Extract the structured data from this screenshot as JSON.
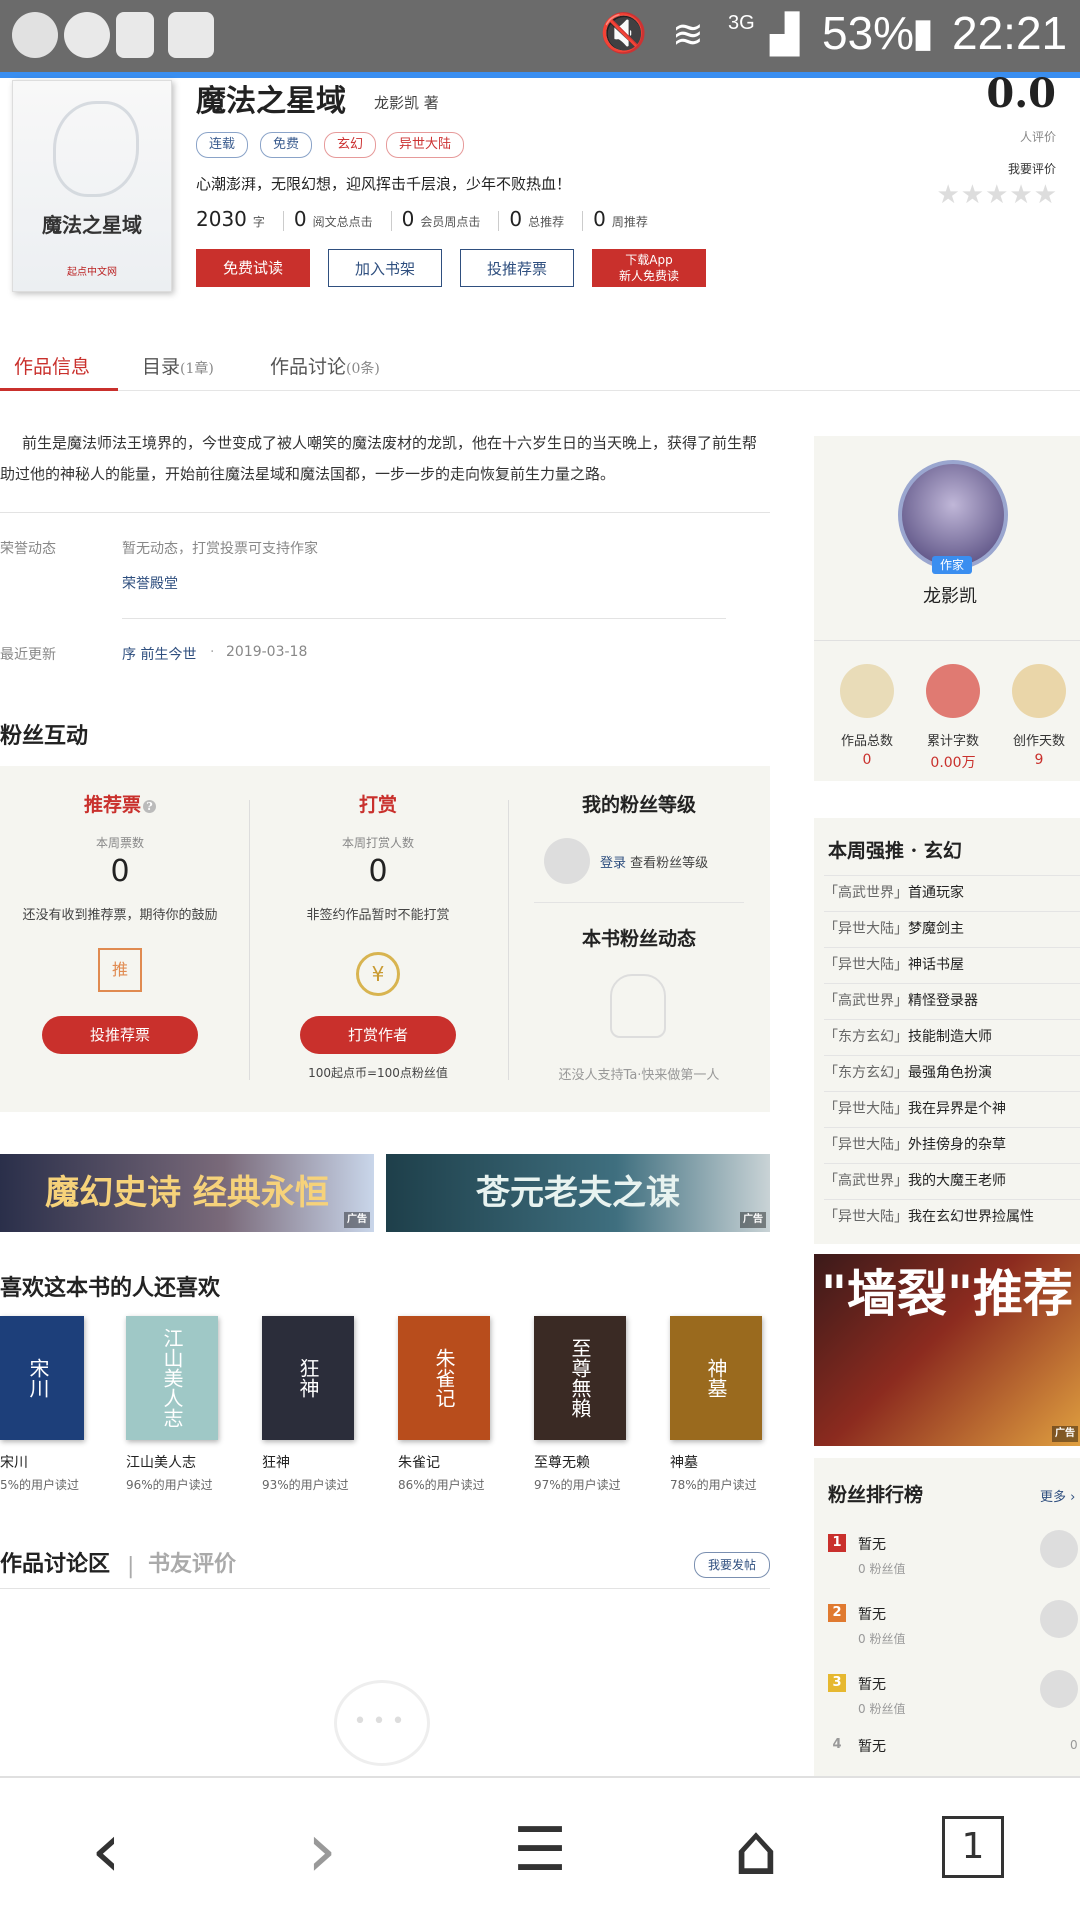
{
  "status_bar": {
    "battery": "53%",
    "time": "22:21",
    "network": "3G"
  },
  "book": {
    "title": "魔法之星域",
    "author": "龙影凯 著",
    "cover_title": "魔法之星域",
    "cover_brand": "起点中文网",
    "tags": [
      {
        "label": "连载",
        "tone": "blue"
      },
      {
        "label": "免费",
        "tone": "blue"
      },
      {
        "label": "玄幻",
        "tone": "red"
      },
      {
        "label": "异世大陆",
        "tone": "red"
      }
    ],
    "intro": "心潮澎湃，无限幻想，迎风挥击千层浪，少年不败热血！",
    "stats": [
      {
        "value": "2030",
        "unit": "字"
      },
      {
        "value": "0",
        "unit": "阅文总点击"
      },
      {
        "value": "0",
        "unit": "会员周点击"
      },
      {
        "value": "0",
        "unit": "总推荐"
      },
      {
        "value": "0",
        "unit": "周推荐"
      }
    ],
    "buttons": {
      "read": "免费试读",
      "shelf": "加入书架",
      "vote": "投推荐票",
      "app_line1": "下载App",
      "app_line2": "新人免费读"
    },
    "rating": {
      "score": "0.0",
      "count_label": "人评价",
      "rate_label": "我要评价",
      "stars": "★★★★★"
    }
  },
  "tabs": [
    {
      "label": "作品信息",
      "sub": ""
    },
    {
      "label": "目录",
      "sub": "(1章)"
    },
    {
      "label": "作品讨论",
      "sub": "(0条)"
    }
  ],
  "description": "前生是魔法师法王境界的，今世变成了被人嘲笑的魔法废材的龙凯，他在十六岁生日的当天晚上，获得了前生帮助过他的神秘人的能量，开始前往魔法星域和魔法国都，一步一步的走向恢复前生力量之路。",
  "honor": {
    "label": "荣誉动态",
    "text": "暂无动态，打赏投票可支持作家",
    "link": "荣誉殿堂"
  },
  "update": {
    "label": "最近更新",
    "chapter": "序 前生今世",
    "dot": "·",
    "date": "2019-03-18"
  },
  "fans": {
    "title": "粉丝互动",
    "vote": {
      "title": "推荐票",
      "help": "?",
      "sub": "本周票数",
      "count": "0",
      "note": "还没有收到推荐票，期待你的鼓励",
      "icon_text": "推",
      "button": "投推荐票"
    },
    "tip": {
      "title": "打赏",
      "sub": "本周打赏人数",
      "count": "0",
      "note": "非签约作品暂时不能打赏",
      "icon_text": "¥",
      "button": "打赏作者",
      "footer": "100起点币=100点粉丝值"
    },
    "level": {
      "title": "我的粉丝等级",
      "login": "登录",
      "login_note": "查看粉丝等级",
      "dynamic_title": "本书粉丝动态",
      "empty": "还没人支持Ta·快来做第一人"
    }
  },
  "banners": [
    {
      "text": "魔幻史诗 经典永恒",
      "ad": "广告"
    },
    {
      "text": "苍元老夫之谋",
      "ad": "广告"
    }
  ],
  "also_like": {
    "title": "喜欢这本书的人还喜欢",
    "books": [
      {
        "cover": "宋川",
        "name": "宋川",
        "pct": "5%的用户读过",
        "color": "#1d3f7a"
      },
      {
        "cover": "江山美人志",
        "name": "江山美人志",
        "pct": "96%的用户读过",
        "color": "#9fc8c6"
      },
      {
        "cover": "狂神",
        "name": "狂神",
        "pct": "93%的用户读过",
        "color": "#2b2d3a"
      },
      {
        "cover": "朱雀记",
        "name": "朱雀记",
        "pct": "86%的用户读过",
        "color": "#b84d1c"
      },
      {
        "cover": "至尊無賴",
        "name": "至尊无赖",
        "pct": "97%的用户读过",
        "color": "#3a2a24"
      },
      {
        "cover": "神墓",
        "name": "神墓",
        "pct": "78%的用户读过",
        "color": "#9a6a1e"
      }
    ]
  },
  "discussion": {
    "title": "作品讨论区",
    "sep": "|",
    "review": "书友评价",
    "post": "我要发帖",
    "dots": "•••"
  },
  "author": {
    "badge": "作家",
    "name": "龙影凯",
    "stats": [
      {
        "label": "作品总数",
        "value": "0",
        "color": "#e9dcb8"
      },
      {
        "label": "累计字数",
        "value": "0.00万",
        "color": "#e07a72"
      },
      {
        "label": "创作天数",
        "value": "9",
        "color": "#ead6a9"
      }
    ]
  },
  "weekly": {
    "title": "本周强推 · 玄幻",
    "items": [
      {
        "cat": "「高武世界」",
        "name": "首通玩家"
      },
      {
        "cat": "「异世大陆」",
        "name": "梦魔剑主"
      },
      {
        "cat": "「异世大陆」",
        "name": "神话书屋"
      },
      {
        "cat": "「高武世界」",
        "name": "精怪登录器"
      },
      {
        "cat": "「东方玄幻」",
        "name": "技能制造大师"
      },
      {
        "cat": "「东方玄幻」",
        "name": "最强角色扮演"
      },
      {
        "cat": "「异世大陆」",
        "name": "我在异界是个神"
      },
      {
        "cat": "「异世大陆」",
        "name": "外挂傍身的杂草"
      },
      {
        "cat": "「高武世界」",
        "name": "我的大魔王老师"
      },
      {
        "cat": "「异世大陆」",
        "name": "我在玄幻世界捡属性"
      }
    ]
  },
  "promo": {
    "text": "\"墙裂\"推荐",
    "ad": "广告"
  },
  "ranking": {
    "title": "粉丝排行榜",
    "more": "更多 ›",
    "items": [
      {
        "rank": "1",
        "name": "暂无",
        "sub": "0 粉丝值",
        "color": "#c9302c"
      },
      {
        "rank": "2",
        "name": "暂无",
        "sub": "0 粉丝值",
        "color": "#e07a30"
      },
      {
        "rank": "3",
        "name": "暂无",
        "sub": "0 粉丝值",
        "color": "#e6b830"
      },
      {
        "rank": "4",
        "name": "暂无",
        "sub": "0",
        "color": "#999"
      }
    ]
  },
  "nav": {
    "back": "‹",
    "forward": "›",
    "menu": "☰",
    "home": "⌂",
    "tabs": "1"
  }
}
